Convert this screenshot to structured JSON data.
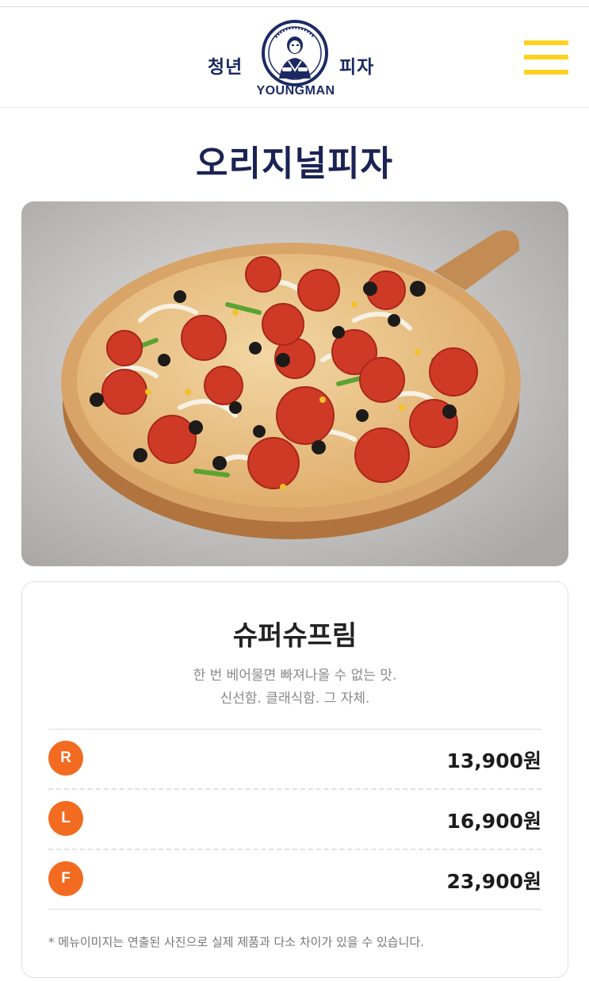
{
  "header": {
    "brand_left": "청년",
    "brand_right": "피자",
    "brand_en": "YOUNGMAN",
    "logo_icon": "youngman-chef-emblem",
    "menu_icon": "hamburger-menu-icon",
    "menu_color": "#ffd21f"
  },
  "page": {
    "title": "오리지널피자"
  },
  "hero": {
    "image": "supreme-pizza-photo"
  },
  "menu": {
    "name": "슈퍼슈프림",
    "description_lines": [
      "한 번 베어물면 빠져나올 수 없는 맛.",
      "신선함. 클래식함. 그 자체."
    ],
    "prices": [
      {
        "size": "R",
        "price": "13,900원"
      },
      {
        "size": "L",
        "price": "16,900원"
      },
      {
        "size": "F",
        "price": "23,900원"
      }
    ],
    "badge_color": "#f26b21",
    "notice": "* 메뉴이미지는 연출된 사진으로 실제 제품과 다소 차이가 있을 수 있습니다."
  },
  "colors": {
    "title_navy": "#1b2354",
    "accent_yellow": "#ffd21f",
    "accent_orange": "#f26b21"
  }
}
